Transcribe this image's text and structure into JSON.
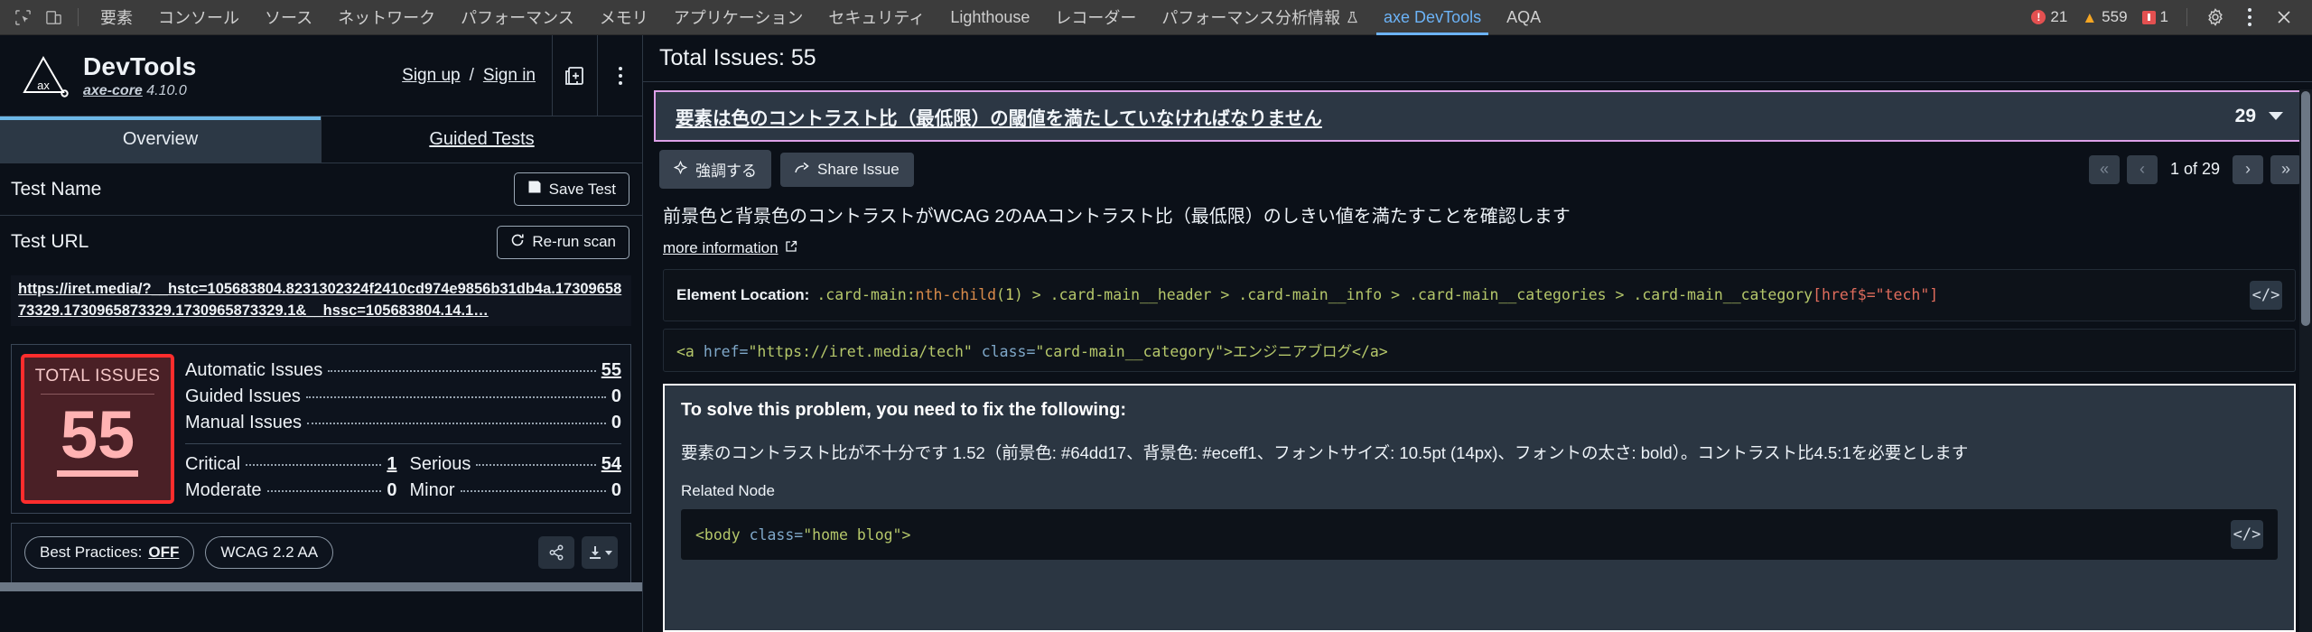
{
  "devtools_bar": {
    "left_icons": [
      {
        "name": "inspect-element-icon"
      },
      {
        "name": "device-toolbar-icon"
      }
    ],
    "tabs": [
      {
        "label": "要素",
        "active": false
      },
      {
        "label": "コンソール",
        "active": false
      },
      {
        "label": "ソース",
        "active": false
      },
      {
        "label": "ネットワーク",
        "active": false
      },
      {
        "label": "パフォーマンス",
        "active": false
      },
      {
        "label": "メモリ",
        "active": false
      },
      {
        "label": "アプリケーション",
        "active": false
      },
      {
        "label": "セキュリティ",
        "active": false
      },
      {
        "label": "Lighthouse",
        "active": false
      },
      {
        "label": "レコーダー",
        "active": false
      },
      {
        "label": "パフォーマンス分析情報",
        "active": false,
        "flask": true
      },
      {
        "label": "axe DevTools",
        "active": true
      },
      {
        "label": "AQA",
        "active": false
      }
    ],
    "counts": {
      "errors": "21",
      "warnings": "559",
      "issues": "1"
    },
    "settings_icon": "gear-icon",
    "kebab_icon": "kebab-menu-icon",
    "close_icon": "close-icon"
  },
  "left_panel": {
    "brand": {
      "title": "DevTools",
      "core_label": "axe-core",
      "version": "4.10.0"
    },
    "auth": {
      "sign_up": "Sign up",
      "separator": "/",
      "sign_in": "Sign in"
    },
    "header_buttons": {
      "new_window": "new-window-icon",
      "kebab": "kebab-menu-icon"
    },
    "tabs": [
      {
        "label": "Overview",
        "active": true
      },
      {
        "label": "Guided Tests",
        "active": false
      }
    ],
    "test_name": {
      "label": "Test Name",
      "save_button": "Save Test",
      "save_icon": "save-disk-icon"
    },
    "test_url": {
      "label": "Test URL",
      "rerun_button": "Re-run scan",
      "rerun_icon": "refresh-icon",
      "url": "https://iret.media/?__hstc=105683804.8231302324f2410cd974e9856b31db4a.1730965873329.1730965873329.1730965873329.1&__hssc=105683804.14.1…"
    },
    "summary": {
      "total_label": "TOTAL ISSUES",
      "total_value": "55",
      "rows": [
        {
          "name": "Automatic Issues",
          "value": "55",
          "underline": true
        },
        {
          "name": "Guided Issues",
          "value": "0",
          "underline": false
        },
        {
          "name": "Manual Issues",
          "value": "0",
          "underline": false
        }
      ],
      "severity": [
        {
          "name": "Critical",
          "value": "1",
          "underline": true
        },
        {
          "name": "Serious",
          "value": "54",
          "underline": true
        },
        {
          "name": "Moderate",
          "value": "0",
          "underline": false
        },
        {
          "name": "Minor",
          "value": "0",
          "underline": false
        }
      ]
    },
    "footer": {
      "best_practices_label": "Best Practices:",
      "best_practices_value": "OFF",
      "standard_chip": "WCAG 2.2 AA",
      "share_icon": "share-icon",
      "download_icon": "download-icon"
    }
  },
  "right_panel": {
    "header": "Total Issues: 55",
    "issue": {
      "title": "要素は色のコントラスト比（最低限）の閾値を満たしていなければなりません",
      "count": "29",
      "caret_icon": "chevron-down-icon"
    },
    "actions": {
      "highlight_label": "強調する",
      "highlight_icon": "highlight-icon",
      "share_label": "Share Issue",
      "share_icon": "share-arrow-icon"
    },
    "pager": {
      "first_icon": "chevrons-left-icon",
      "prev_icon": "chevron-left-icon",
      "label": "1 of 29",
      "next_icon": "chevron-right-icon",
      "last_icon": "chevrons-right-icon"
    },
    "description": "前景色と背景色のコントラストがWCAG 2のAAコントラスト比（最低限）のしきい値を満たすことを確認します",
    "more_information": "more information",
    "more_information_icon": "external-link-icon",
    "element_location": {
      "label": "Element Location:",
      "parts": [
        {
          "text": ".card-main:",
          "cls": "c-green"
        },
        {
          "text": "nth-child",
          "cls": "c-orange"
        },
        {
          "text": "(",
          "cls": "c-green"
        },
        {
          "text": "1",
          "cls": "c-yellow"
        },
        {
          "text": ")",
          "cls": "c-green"
        },
        {
          "text": " > ",
          "cls": "c-green"
        },
        {
          "text": ".card-main__header",
          "cls": "c-green"
        },
        {
          "text": " > ",
          "cls": "c-green"
        },
        {
          "text": ".card-main__info",
          "cls": "c-green"
        },
        {
          "text": " > ",
          "cls": "c-green"
        },
        {
          "text": ".card-main__categories",
          "cls": "c-green"
        },
        {
          "text": " > ",
          "cls": "c-green"
        },
        {
          "text": ".card-main__category",
          "cls": "c-green"
        },
        {
          "text": "[href$=\"tech\"]",
          "cls": "c-red"
        }
      ],
      "code_icon": "code-brackets-icon"
    },
    "snippet": {
      "parts": [
        {
          "text": "<a ",
          "cls": "c-green"
        },
        {
          "text": "href=",
          "cls": "c-blue"
        },
        {
          "text": "\"https://iret.media/tech\"",
          "cls": "c-green"
        },
        {
          "text": " class=",
          "cls": "c-blue"
        },
        {
          "text": "\"card-main__category\"",
          "cls": "c-green"
        },
        {
          "text": ">エンジニアブログ</a>",
          "cls": "c-green"
        }
      ]
    },
    "solve": {
      "title": "To solve this problem, you need to fix the following:",
      "detail": "要素のコントラスト比が不十分です 1.52（前景色: #64dd17、背景色: #eceff1、フォントサイズ: 10.5pt (14px)、フォントの太さ: bold）。コントラスト比4.5:1を必要とします",
      "related_label": "Related Node",
      "related_code_parts": [
        {
          "text": "<body ",
          "cls": "c-green"
        },
        {
          "text": "class=",
          "cls": "c-blue"
        },
        {
          "text": "\"home blog\"",
          "cls": "c-green"
        },
        {
          "text": ">",
          "cls": "c-green"
        }
      ],
      "related_code_icon": "code-brackets-icon"
    }
  },
  "colors": {
    "accent_blue": "#6cb3f7",
    "issue_border_pink": "#dda0e8",
    "total_red": "#ff2d2d",
    "total_number": "#ffb3b3",
    "panel_bg": "#0b1018"
  }
}
